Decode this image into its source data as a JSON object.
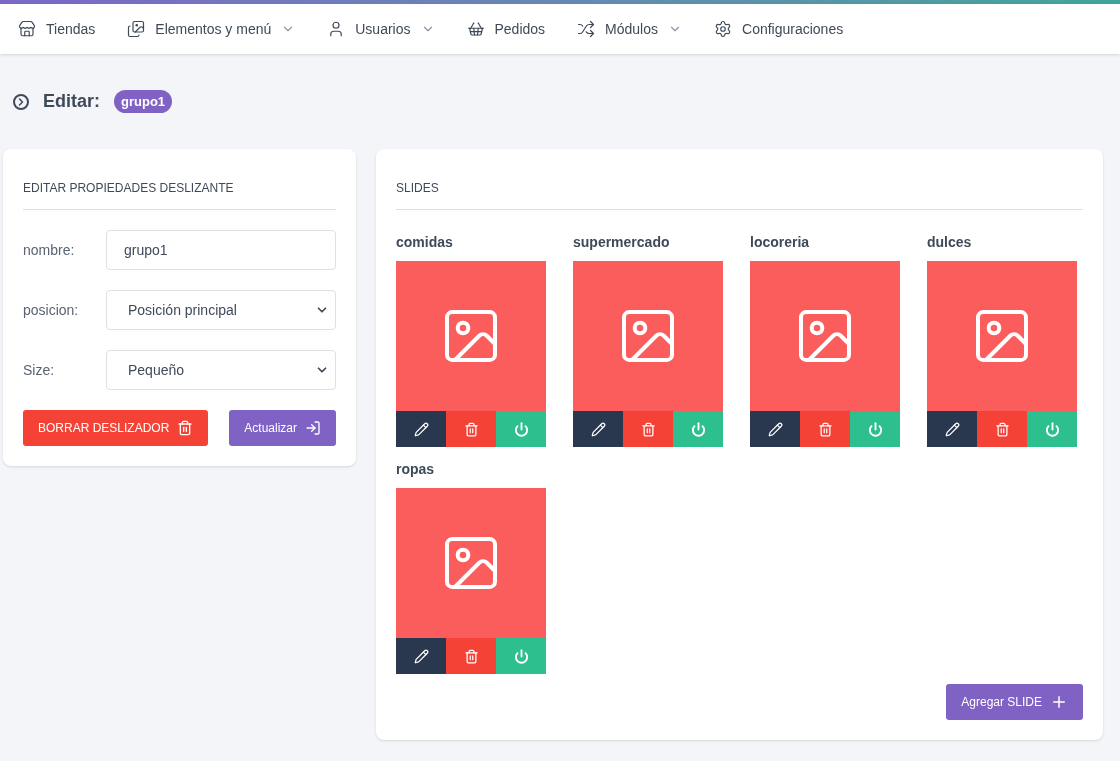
{
  "nav": [
    {
      "label": "Tiendas",
      "has_menu": false
    },
    {
      "label": "Elementos y menú",
      "has_menu": true
    },
    {
      "label": "Usuarios",
      "has_menu": true
    },
    {
      "label": "Pedidos",
      "has_menu": false
    },
    {
      "label": "Módulos",
      "has_menu": true
    },
    {
      "label": "Configuraciones",
      "has_menu": false
    }
  ],
  "page": {
    "title": "Editar:",
    "badge": "grupo1"
  },
  "properties": {
    "heading": "EDITAR PROPIEDADES DESLIZANTE",
    "fields": [
      {
        "kind": "input",
        "label": "nombre:",
        "value": "grupo1"
      },
      {
        "kind": "select",
        "label": "posicion:",
        "value": "Posición principal"
      },
      {
        "kind": "select",
        "label": "Size:",
        "value": "Pequeño"
      }
    ],
    "delete_button": "BORRAR DESLIZADOR",
    "update_button": "Actualizar"
  },
  "slides": {
    "heading": "SLIDES",
    "items": [
      {
        "name": "comidas"
      },
      {
        "name": "supermercado"
      },
      {
        "name": "locoreria"
      },
      {
        "name": "dulces"
      },
      {
        "name": "ropas"
      }
    ],
    "add_button": "Agregar SLIDE"
  }
}
